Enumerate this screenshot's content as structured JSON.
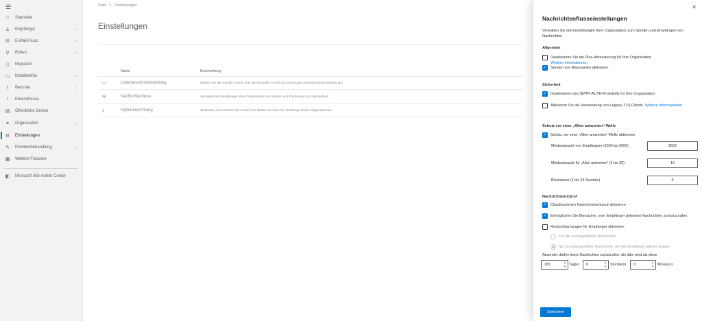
{
  "nav": {
    "items": [
      {
        "label": "Startseite",
        "icon": "home-icon",
        "chevron": ""
      },
      {
        "label": "Empfänger",
        "icon": "person-icon",
        "chevron": "⌄"
      },
      {
        "label": "E-Mail-Fluss",
        "icon": "mail-icon",
        "chevron": "⌄"
      },
      {
        "label": "Rollen",
        "icon": "roles-icon",
        "chevron": "⌄"
      },
      {
        "label": "Migration",
        "icon": "migration-icon",
        "chevron": ""
      },
      {
        "label": "Mobiltelefon",
        "icon": "mobile-icon",
        "chevron": "⌄"
      },
      {
        "label": "Berichte",
        "icon": "chart-icon",
        "chevron": "⌄"
      },
      {
        "label": "Erkenntnisse",
        "icon": "lightbulb-icon",
        "chevron": ""
      },
      {
        "label": "Öffentliche Ordner",
        "icon": "folder-icon",
        "chevron": ""
      },
      {
        "label": "Organisation",
        "icon": "organization-icon",
        "chevron": "⌄"
      },
      {
        "label": "Einstellungen",
        "icon": "gear-icon",
        "chevron": ""
      },
      {
        "label": "Problembehandlung",
        "icon": "wrench-icon",
        "chevron": "⌄"
      },
      {
        "label": "Weitere Features",
        "icon": "grid-icon",
        "chevron": ""
      }
    ],
    "admin_center": "Microsoft 365 Admin Center"
  },
  "main": {
    "breadcrumb": [
      "Start",
      ">",
      "Einstellungen"
    ],
    "title": "Einstellungen",
    "columns": {
      "name": "Name",
      "description": "Beschreibung"
    },
    "rows": [
      {
        "name": "Listenansichtseinstellung",
        "description": "Wählen Sie die normale Ansicht oder die kompakte Ansicht als bevorzugte Listenansichtseinstellung aus."
      },
      {
        "name": "Nachrichtenfluss",
        "description": "Verwalten der Einstellungen Ihrer Organisation zum Senden und Empfangen von Nachrichten."
      },
      {
        "name": "Hybrideinrichtung",
        "description": "Verbinden und verwalten Sie sowohl Ihre lokalen als auch Ihre Exchange Online-Organisationen."
      }
    ]
  },
  "panel": {
    "title": "Nachrichtenflusseinstellungen",
    "description": "Verwalten Sie die Einstellungen Ihrer Organisation zum Senden und Empfangen von Nachrichten.",
    "general": {
      "heading": "Allgemein",
      "plus_addressing": "Deaktivieren Sie die Plus-Adressierung für Ihre Organisation.",
      "more_info": "Weitere Informationen",
      "send_from_alias": "Senden von Aliasnamen aktivieren"
    },
    "security": {
      "heading": "Sicherheit",
      "smtp_auth": "Deaktivieren des SMTP-AUTH-Protokolls für Ihre Organisation",
      "legacy_tls": "Aktivieren Sie die Verwendung von Legacy-TLS-Clients.",
      "more_info": "Weitere Informationen"
    },
    "reply_all": {
      "heading": "Schutz vor einer „Allen antworten“-Welle",
      "enable": "Schutz vor einer „Allen antworten“-Welle aktivieren",
      "min_recipients_label": "Mindestanzahl von Empfängern (1000 bis 5000)",
      "min_recipients": "2500",
      "min_reply_all_label": "Mindestanzahl für „Allen antworten“ (2 bis 20)",
      "min_reply_all": "10",
      "block_duration_label": "Blockdauer (1 bis 24 Stunden)",
      "block_duration": "6"
    },
    "recall": {
      "heading": "Nachrichtenrückruf",
      "cloud_recall": "Cloudbasierten Nachrichtenrückruf aktivieren",
      "allow_read_recall": "Ermöglichen Sie Benutzern, vom Empfänger gelesene Nachrichten zurückzurufen",
      "recall_alerts": "Rückrufwarnungen für Empfänger aktivieren",
      "radio_all": "Für alle zurückgerufenen Nachrichten",
      "radio_read": "Nur für zurückgerufene Nachrichten, die vom Empfänger gelesen wurden",
      "age_label": "Absender dürfen keine Nachrichten zurückrufen, die älter sind als diese",
      "days": "365",
      "days_unit": "Tag(e)",
      "hours": "0",
      "hours_unit": "Stunde(n)",
      "minutes": "0",
      "minutes_unit": "Minute(n)"
    },
    "save": "Speichern",
    "close_icon": "close-icon"
  },
  "colors": {
    "accent": "#0078d4",
    "nav_bg": "#f3f2f1"
  }
}
